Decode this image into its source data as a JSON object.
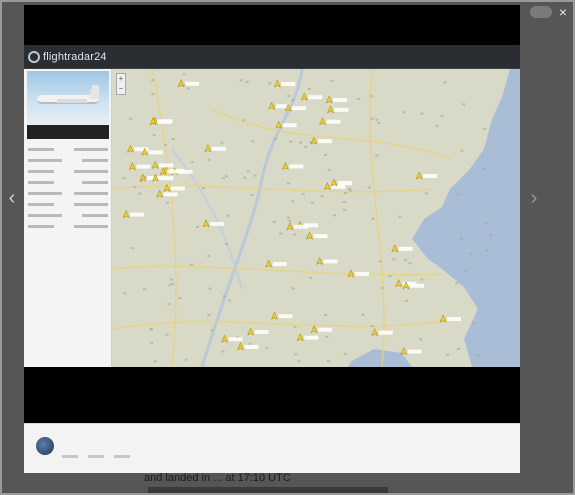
{
  "app": {
    "logo_text": "flightradar24"
  },
  "menu": [
    "",
    "",
    "",
    "",
    "",
    ""
  ],
  "aircraft": {
    "caption_line1": "",
    "caption_line2": ""
  },
  "map": {
    "water_color": "#a9bdd6",
    "land_color": "#d9d9c7",
    "road_color": "#e8d27a",
    "aircraft_color": "#f3d21b",
    "label_color": "#ffffff",
    "aircraft_count": 48
  },
  "comment": {
    "author": "",
    "text": ""
  },
  "caption": "and landed in ... at 17:10 UTC",
  "icons": {
    "close": "close-icon",
    "prev": "chevron-left-icon",
    "next": "chevron-right-icon",
    "zoom_in": "plus-icon",
    "zoom_out": "minus-icon",
    "aircraft": "airplane-icon"
  }
}
